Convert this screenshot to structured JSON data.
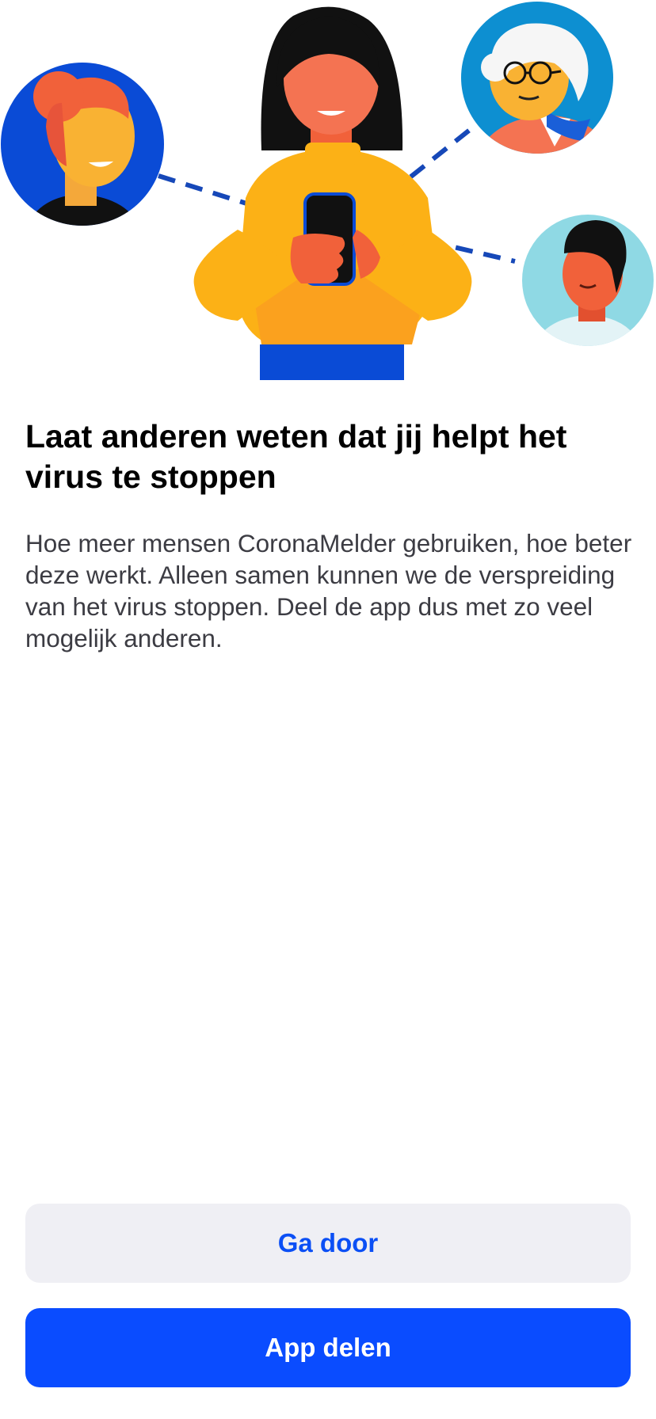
{
  "screen": {
    "illustration_icon": "people-sharing-app-illustration",
    "title": "Laat anderen weten dat jij helpt het virus te stoppen",
    "body": "Hoe meer mensen CoronaMelder gebruiken, hoe beter deze werkt. Alleen samen kunnen we de verspreiding van het virus stoppen. Deel de app dus met zo veel mogelijk anderen."
  },
  "actions": {
    "continue_label": "Ga door",
    "share_label": "App delen"
  },
  "colors": {
    "primary_blue": "#0A4CFF",
    "secondary_button_bg": "#EFEFF4",
    "title_text": "#000000",
    "body_text": "#3C3C43"
  }
}
